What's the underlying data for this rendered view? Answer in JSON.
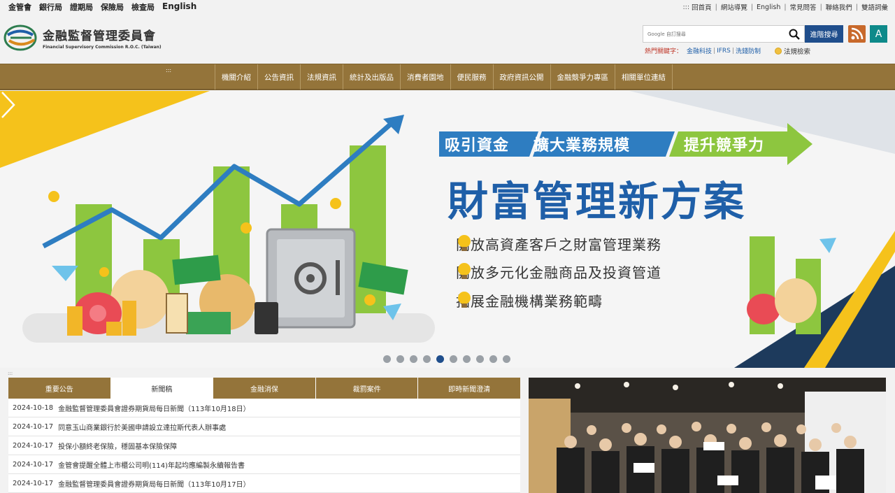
{
  "top_links": {
    "agencies": [
      "金管會",
      "銀行局",
      "證期局",
      "保險局",
      "檢查局"
    ],
    "english": "English"
  },
  "utility": {
    "marker": ":::",
    "items": [
      "回首頁",
      "網站導覽",
      "English",
      "常見問答",
      "聯絡我們",
      "雙語詞彙"
    ]
  },
  "logo": {
    "name_zh": "金融監督管理委員會",
    "name_en": "Financial Supervisory Commission R.O.C. (Taiwan)"
  },
  "search": {
    "placeholder": "Google 自訂搜尋",
    "advanced_label": "進階搜尋",
    "a_label": "A"
  },
  "hot_keywords": {
    "label": "熱門關鍵字：",
    "items": [
      "金融科技",
      "IFRS",
      "洗錢防制"
    ],
    "law_search": "法規檢索"
  },
  "nav": {
    "marker": ":::",
    "items": [
      "機關介紹",
      "公告資訊",
      "法規資訊",
      "統計及出版品",
      "消費者園地",
      "便民服務",
      "政府資訊公開",
      "金融競爭力專區",
      "相關單位連結"
    ]
  },
  "banner": {
    "slogans": [
      "吸引資金",
      "擴大業務規模",
      "提升競爭力"
    ],
    "title": "財富管理新方案",
    "points": [
      "開放高資產客戶之財富管理業務",
      "開放多元化金融商品及投資管道",
      "拓展金融機構業務範疇"
    ],
    "slide_count": 10,
    "active_slide": 5,
    "colors": {
      "yellow": "#f5c21b",
      "navy": "#1d3a5c",
      "blue": "#1f5fa8",
      "green": "#8dc63f",
      "tag_blue": "#2e7dc1",
      "tag_green": "#8dc63f"
    }
  },
  "news": {
    "marker": ":::",
    "tabs": [
      "重要公告",
      "新聞稿",
      "金融消保",
      "裁罰案件",
      "即時新聞澄清"
    ],
    "active_tab": 1,
    "rows": [
      {
        "date": "2024-10-18",
        "title": "金融監督管理委員會證券期貨局每日新聞（113年10月18日）"
      },
      {
        "date": "2024-10-17",
        "title": "同意玉山商業銀行於美國申請設立達拉斯代表人辦事處"
      },
      {
        "date": "2024-10-17",
        "title": "投保小額終老保險，穩固基本保險保障"
      },
      {
        "date": "2024-10-17",
        "title": "金管會提醒全體上市櫃公司明(114)年起均應編製永續報告書"
      },
      {
        "date": "2024-10-17",
        "title": "金融監督管理委員會證券期貨局每日新聞（113年10月17日）"
      }
    ]
  }
}
